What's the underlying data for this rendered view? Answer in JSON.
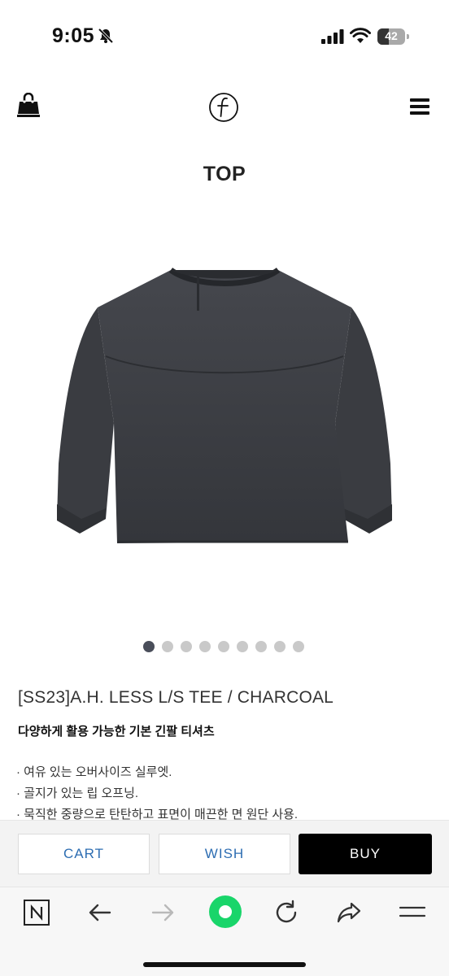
{
  "status_bar": {
    "time": "9:05",
    "battery_level": "42",
    "battery_fraction": 0.42,
    "icons": [
      "bell-slash-icon",
      "signal-icon",
      "wifi-icon",
      "battery-icon"
    ]
  },
  "header": {
    "icons": [
      "shopping-bag-icon",
      "brand-logo-icon",
      "hamburger-menu-icon"
    ]
  },
  "page": {
    "title": "TOP"
  },
  "gallery": {
    "image": "charcoal-long-sleeve-tee",
    "total_images": 9,
    "active_index": 0
  },
  "product": {
    "name": "[SS23]A.H. LESS L/S TEE / CHARCOAL",
    "subtitle": "다양하게 활용 가능한 기본 긴팔 티셔츠",
    "features": [
      "· 여유 있는 오버사이즈 실루엣.",
      "· 골지가 있는 립 오프닝.",
      "· 묵직한 중량으로 탄탄하고 표면이 매끈한 면 원단 사용."
    ]
  },
  "actions": {
    "cart_label": "CART",
    "wish_label": "WISH",
    "buy_label": "BUY"
  },
  "colors": {
    "accent_blue": "#2d6db2",
    "buy_bg": "#000000",
    "garment": "#3b3d42",
    "dot_active": "#4a4e5a",
    "dot_inactive": "#c9c9c9",
    "naver_green": "#19d56a"
  },
  "browser_toolbar": {
    "icons": [
      "naver-n-icon",
      "back-arrow-icon",
      "forward-arrow-icon",
      "green-dot-icon",
      "reload-icon",
      "share-icon",
      "menu-lines-icon"
    ]
  }
}
